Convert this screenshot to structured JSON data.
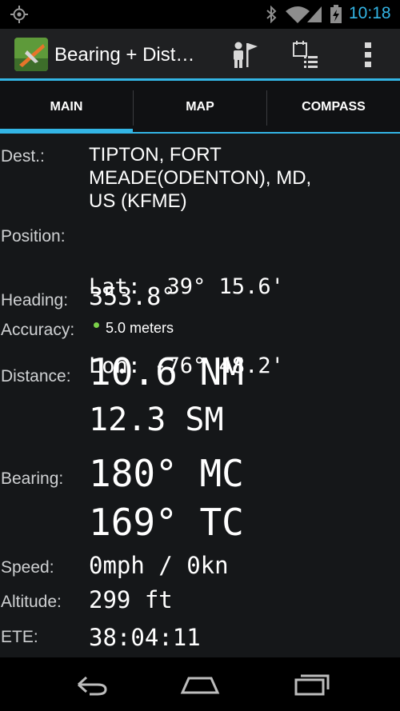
{
  "status_bar": {
    "time": "10:18",
    "icons": [
      "gps-icon",
      "bluetooth-icon",
      "wifi-icon",
      "cell-signal-icon",
      "battery-charging-icon"
    ]
  },
  "action_bar": {
    "title": "Bearing + Dist…",
    "app_icon": "airplane-app-icon",
    "actions": [
      "destination-person-flag-icon",
      "calendar-list-icon",
      "overflow-menu-icon"
    ]
  },
  "tabs": [
    {
      "label": "MAIN",
      "selected": true
    },
    {
      "label": "MAP",
      "selected": false
    },
    {
      "label": "COMPASS",
      "selected": false
    }
  ],
  "main": {
    "dest": {
      "label": "Dest.:",
      "lines": [
        "TIPTON, FORT",
        "MEADE(ODENTON), MD,",
        "US (KFME)"
      ]
    },
    "position": {
      "label": "Position:",
      "lat": "Lat:  39° 15.6'",
      "lon": "Lon: -76° 48.2'"
    },
    "heading": {
      "label": "Heading:",
      "value": "353.8°"
    },
    "accuracy": {
      "label": "Accuracy:",
      "value": "5.0 meters",
      "indicator_color": "#7bd14a"
    },
    "distance": {
      "label": "Distance:",
      "nm": "10.6 NM",
      "sm": "12.3 SM"
    },
    "bearing": {
      "label": "Bearing:",
      "mc": "180° MC",
      "tc": "169° TC"
    },
    "speed": {
      "label": "Speed:",
      "value": "0mph / 0kn"
    },
    "altitude": {
      "label": "Altitude:",
      "value": "299 ft"
    },
    "ete": {
      "label": "ETE:",
      "value": "38:04:11"
    }
  },
  "nav_bar": {
    "buttons": [
      "back-icon",
      "home-icon",
      "recent-apps-icon"
    ]
  },
  "colors": {
    "accent": "#33b5e5",
    "background": "#151719"
  }
}
